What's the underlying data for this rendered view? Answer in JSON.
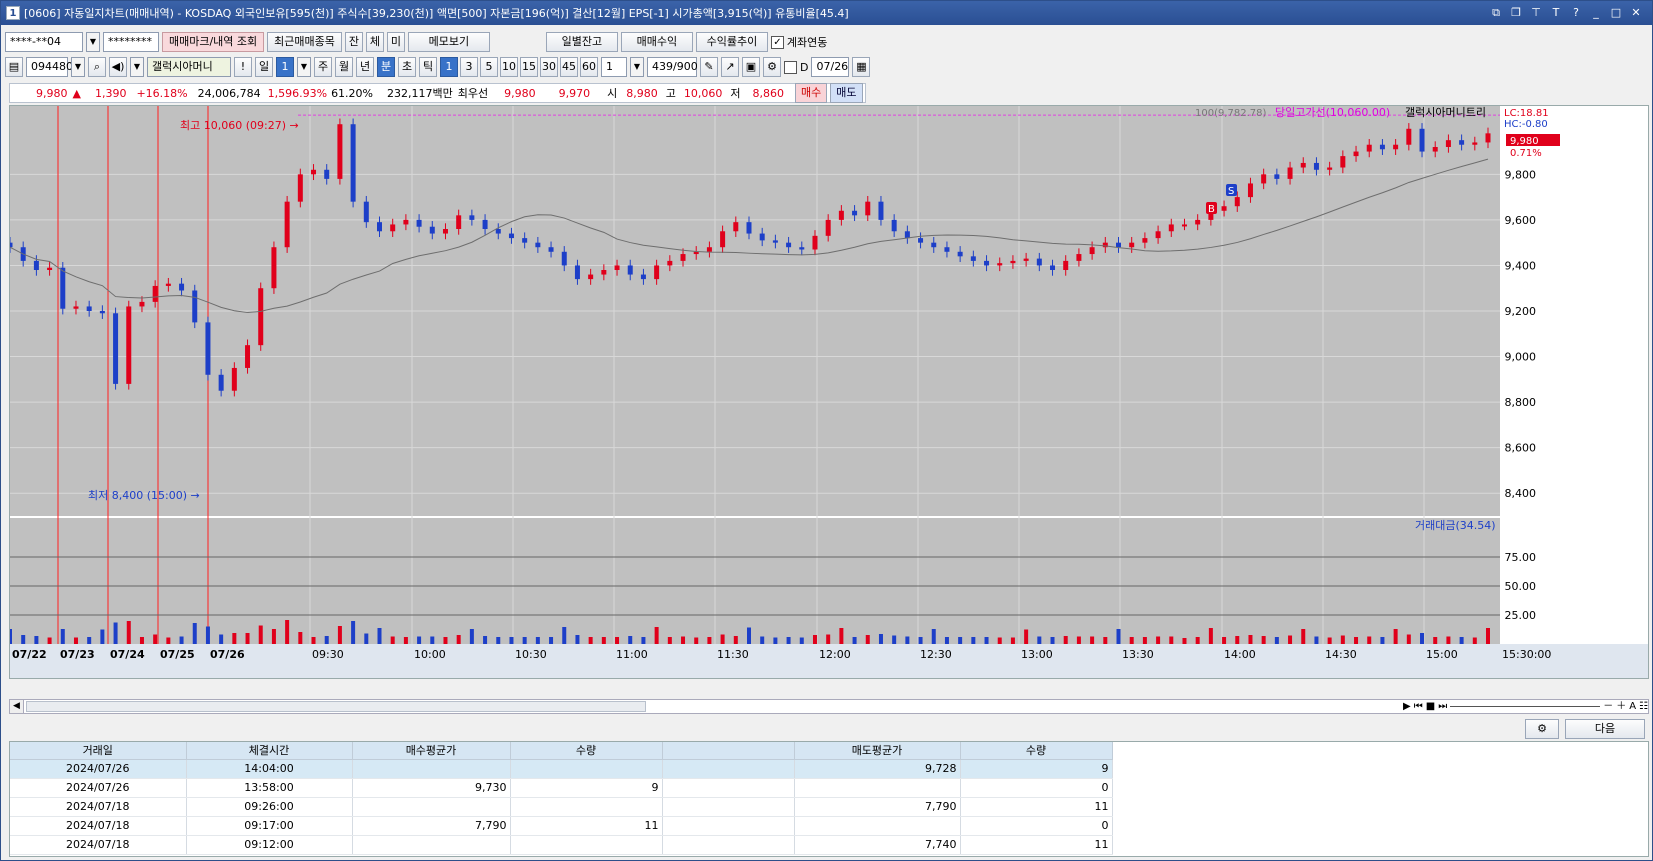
{
  "title": "[0606] 자동일지차트(매매내역) - KOSDAQ 외국인보유[595(천)] 주식수[39,230(천)] 액면[500] 자본금[196(억)] 결산[12월] EPS[-1] 시가총액[3,915(억)] 유통비율[45.4]",
  "window_num": "1",
  "toolbar1": {
    "account": "****-**04",
    "password": "********",
    "mark_btn": "매매마크/내역 조회",
    "recent_btn": "최근매매종목",
    "jan": "잔",
    "che": "체",
    "mi": "미",
    "memo_btn": "메모보기",
    "daily_btn": "일별잔고",
    "profit_btn": "매매수익",
    "rate_btn": "수익률추이",
    "link_label": "계좌연동"
  },
  "toolbar2": {
    "code": "094480",
    "name": "갤럭시아머니",
    "exclaim": "!",
    "period_day": "일",
    "period_num": "1",
    "week": "주",
    "month": "월",
    "year": "년",
    "minute": "분",
    "second": "초",
    "tick": "틱",
    "intervals": [
      "1",
      "3",
      "5",
      "10",
      "15",
      "30",
      "45",
      "60"
    ],
    "count": "1",
    "display": "439/900",
    "d_label": "D",
    "date": "07/26"
  },
  "quote": {
    "price": "9,980",
    "arrow": "▲",
    "change": "1,390",
    "rate": "+16.18%",
    "volume": "24,006,784",
    "vol_rate": "1,596.93%",
    "ratio": "61.20%",
    "amount": "232,117백만",
    "best_label": "최우선",
    "best_ask": "9,980",
    "best_bid": "9,970",
    "open_label": "시",
    "open": "8,980",
    "high_label": "고",
    "high": "10,060",
    "low_label": "저",
    "low": "8,860",
    "buy_btn": "매수",
    "sell_btn": "매도"
  },
  "chart": {
    "legend_ma": "100(9,782.78)",
    "legend_high": "당일고가선(10,060.00)",
    "legend_name": "갤럭시아머니트리",
    "lc": "LC:18.81",
    "hc": "HC:-0.80",
    "price_tag": "9,980",
    "rate_tag": "0.71%",
    "high_note": "최고 10,060 (09:27)",
    "low_note": "최저 8,400 (15:00)",
    "vol_legend": "거래대금(34.54)",
    "price_axis": [
      "9,800",
      "9,600",
      "9,400",
      "9,200",
      "9,000",
      "8,800",
      "8,600",
      "8,400"
    ],
    "vol_axis": [
      "75.00",
      "50.00",
      "25.00"
    ],
    "x_labels": [
      "07/22",
      "07/23",
      "07/24",
      "07/25",
      "07/26",
      "09:30",
      "10:00",
      "10:30",
      "11:00",
      "11:30",
      "12:00",
      "12:30",
      "13:00",
      "13:30",
      "14:00",
      "14:30",
      "15:00",
      "15:30:00"
    ],
    "buy_mark": "B",
    "sell_mark": "S",
    "colors": {
      "up": "#e0001b",
      "down": "#1d3fc8",
      "bg": "#c0c0c0",
      "ma": "#6e6e6e",
      "high_line": "#e040e0"
    }
  },
  "chart_data": {
    "type": "candlestick",
    "y_range": [
      8300,
      10100
    ],
    "close_path": [
      9480,
      9420,
      9380,
      9390,
      9210,
      9220,
      9200,
      9190,
      8880,
      9220,
      9240,
      9310,
      9320,
      9290,
      9150,
      8920,
      8850,
      8950,
      9050,
      9300,
      9480,
      9680,
      9800,
      9820,
      9780,
      10020,
      9680,
      9590,
      9550,
      9580,
      9600,
      9570,
      9540,
      9560,
      9620,
      9600,
      9560,
      9540,
      9520,
      9500,
      9480,
      9460,
      9400,
      9340,
      9360,
      9380,
      9400,
      9360,
      9340,
      9400,
      9420,
      9450,
      9460,
      9480,
      9550,
      9590,
      9540,
      9510,
      9500,
      9480,
      9470,
      9530,
      9600,
      9640,
      9620,
      9680,
      9600,
      9550,
      9520,
      9500,
      9480,
      9460,
      9440,
      9420,
      9400,
      9410,
      9420,
      9430,
      9400,
      9380,
      9420,
      9450,
      9480,
      9500,
      9480,
      9500,
      9520,
      9550,
      9580,
      9580,
      9600,
      9640,
      9660,
      9700,
      9760,
      9800,
      9780,
      9830,
      9850,
      9820,
      9830,
      9880,
      9900,
      9930,
      9910,
      9930,
      10000,
      9900,
      9920,
      9950,
      9930,
      9940,
      9980
    ],
    "volume_levels": [
      75,
      50,
      25
    ],
    "volume_range": [
      0,
      100
    ]
  },
  "bottom": {
    "next_btn": "다음",
    "headers": [
      "거래일",
      "체결시간",
      "매수평균가",
      "수량",
      "",
      "매도평균가",
      "수량"
    ],
    "rows": [
      [
        "2024/07/26",
        "14:04:00",
        "",
        "",
        "",
        "9,728",
        "9"
      ],
      [
        "2024/07/26",
        "13:58:00",
        "9,730",
        "9",
        "",
        "",
        "0"
      ],
      [
        "2024/07/18",
        "09:26:00",
        "",
        "",
        "",
        "7,790",
        "11"
      ],
      [
        "2024/07/18",
        "09:17:00",
        "7,790",
        "11",
        "",
        "",
        "0"
      ],
      [
        "2024/07/18",
        "09:12:00",
        "",
        "",
        "",
        "7,740",
        "11"
      ]
    ]
  }
}
